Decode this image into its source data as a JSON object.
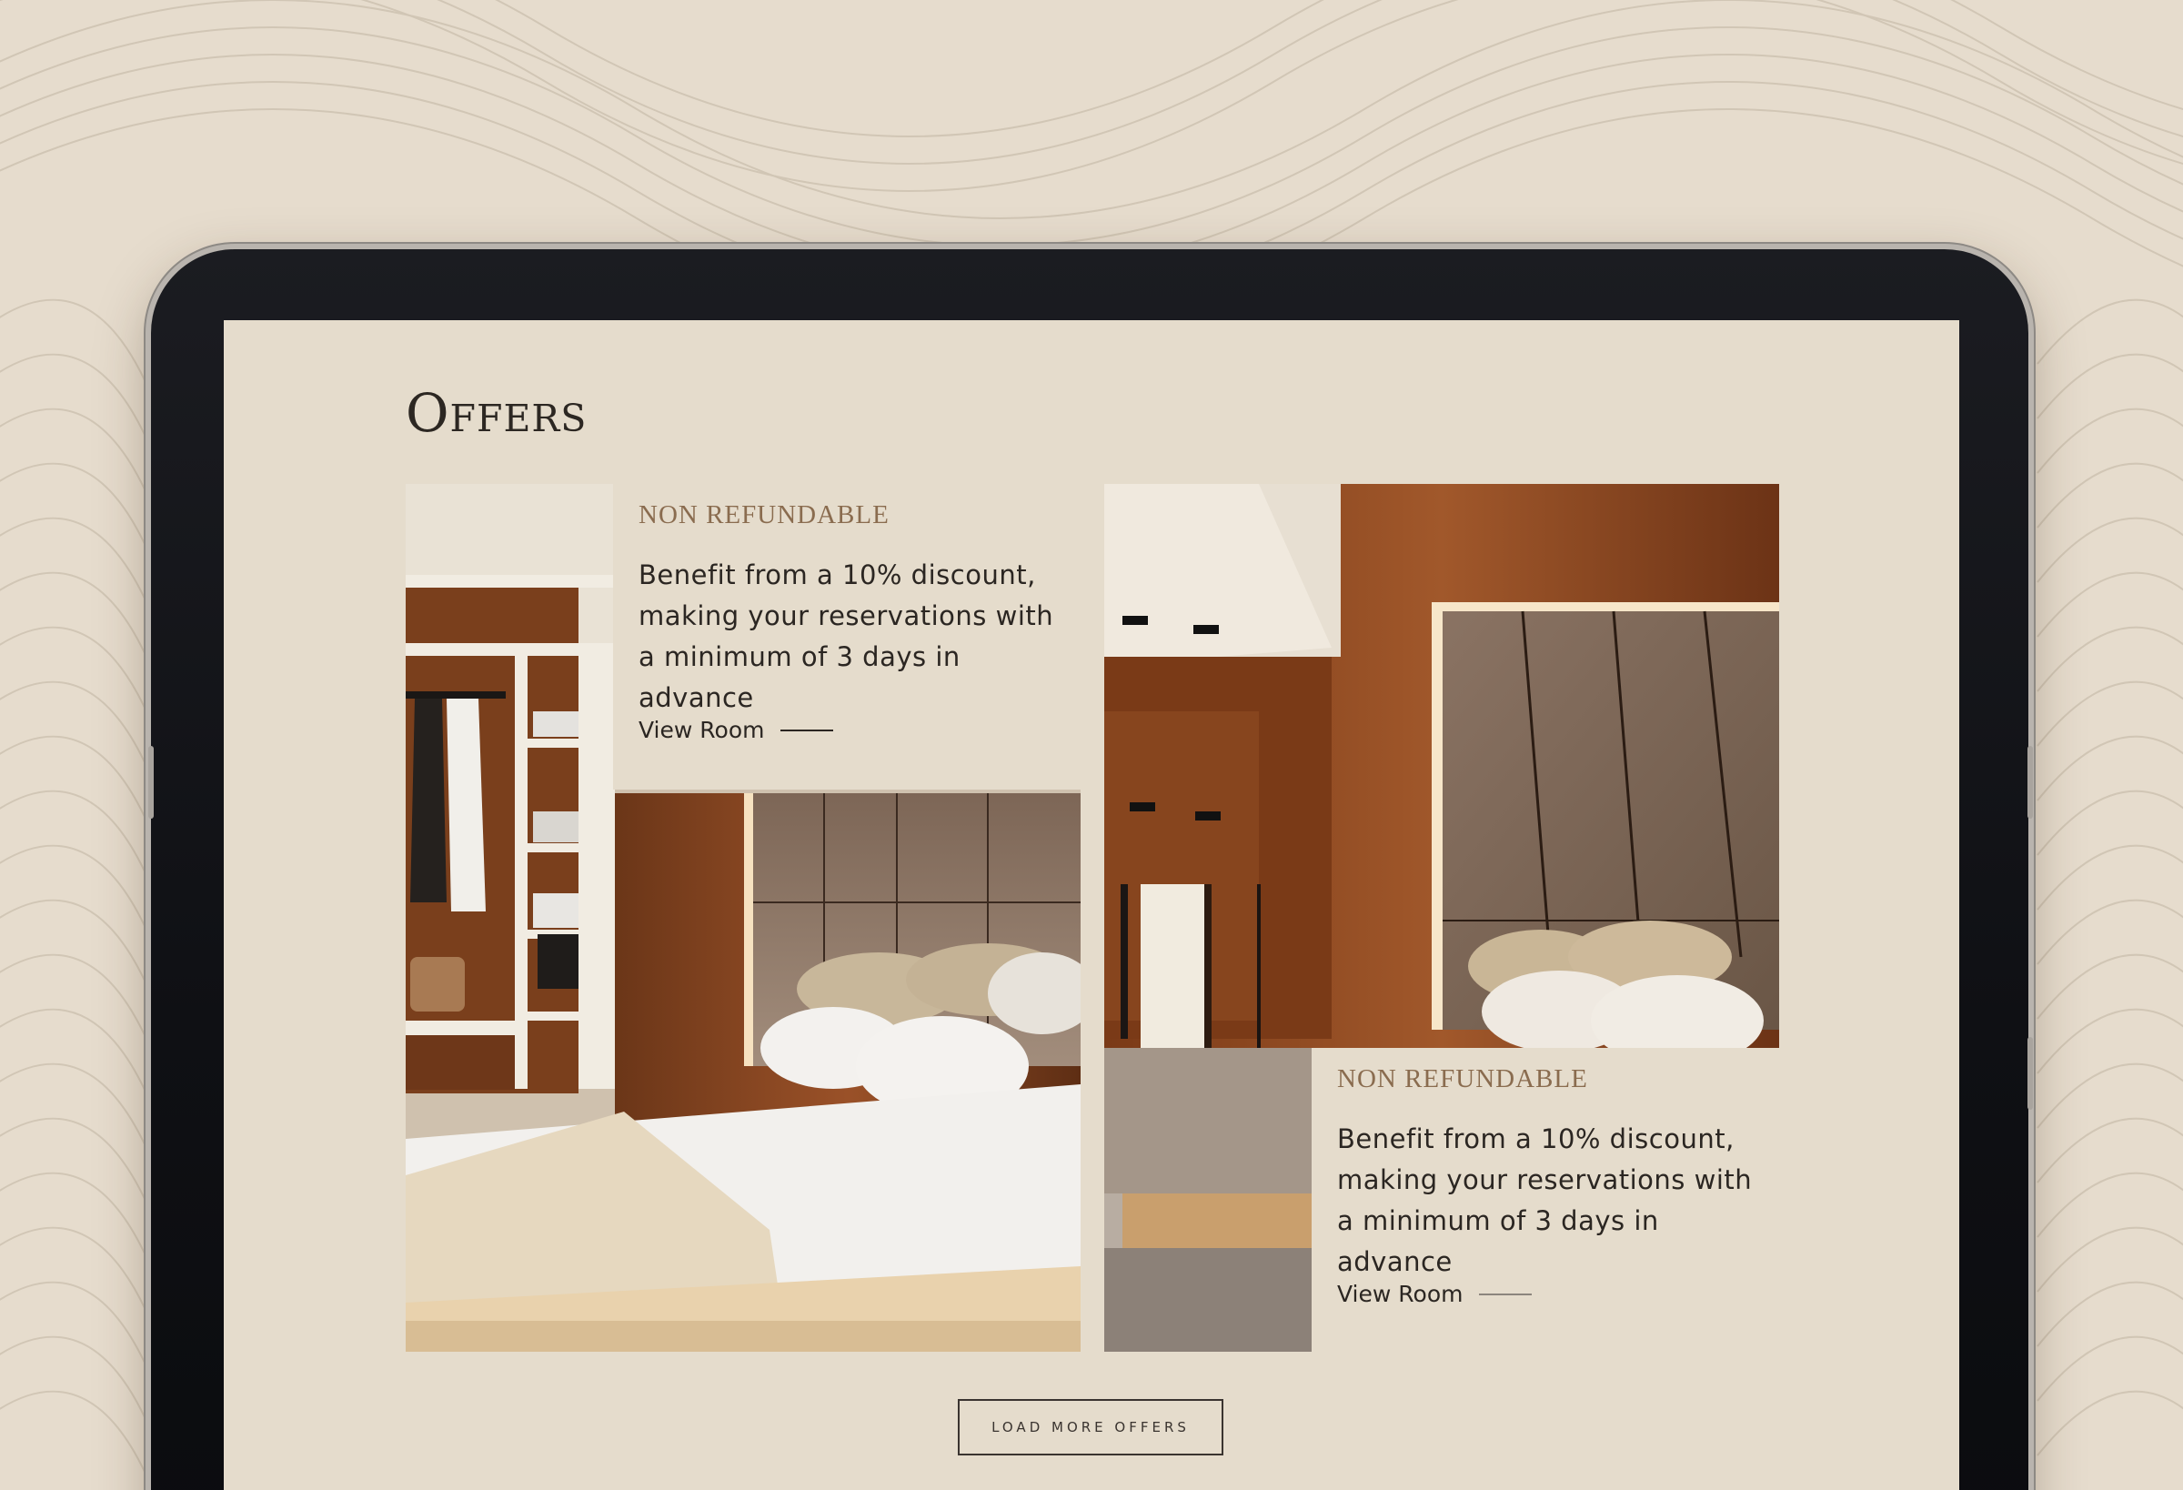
{
  "page": {
    "title": "Offers"
  },
  "offers": [
    {
      "label": "NON REFUNDABLE",
      "description": "Benefit from a 10% discount, making your reservations with a minimum of 3 days in advance",
      "link": "View Room"
    },
    {
      "label": "NON REFUNDABLE",
      "description": "Benefit from a 10% discount, making your reservations with a minimum of 3 days in advance",
      "link": "View Room"
    }
  ],
  "load_more": {
    "label": "LOAD MORE OFFERS"
  },
  "colors": {
    "background": "#e6dccd",
    "screen": "#e5dccc",
    "tablet_frame": "#121317",
    "label_accent": "#8a6c4f",
    "text": "#2b2622"
  },
  "icons": {
    "background_pattern": "wave-line-pattern"
  }
}
